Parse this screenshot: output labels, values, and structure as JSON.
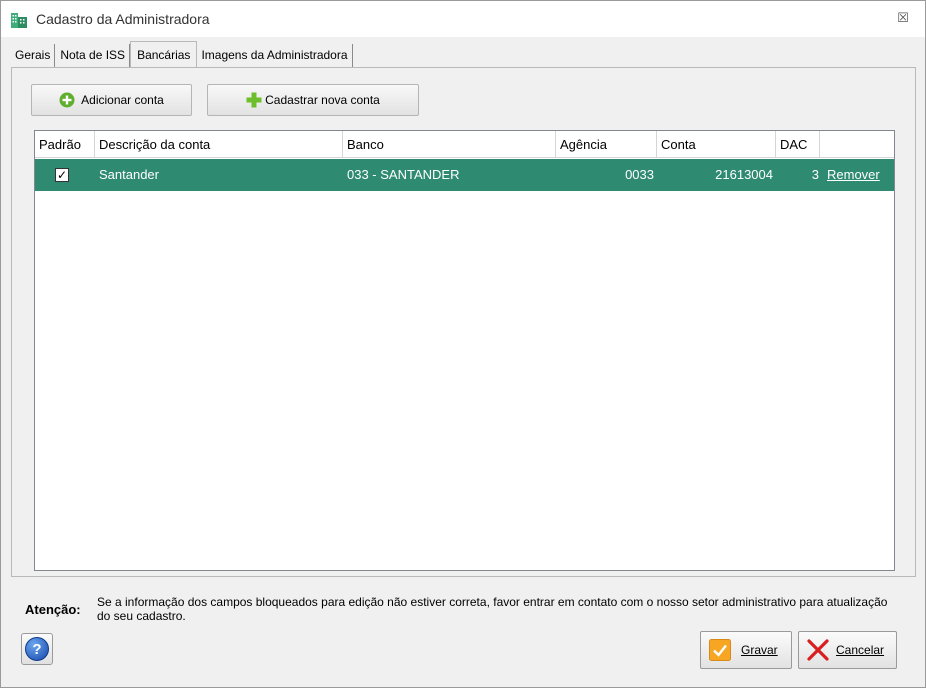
{
  "window": {
    "title": "Cadastro da Administradora",
    "close_glyph": "☒"
  },
  "tabs": [
    {
      "label": "Gerais",
      "active": false
    },
    {
      "label": "Nota de ISS",
      "active": false
    },
    {
      "label": "Bancárias",
      "active": true
    },
    {
      "label": "Imagens da Administradora",
      "active": false
    }
  ],
  "toolbar": {
    "add_account_label": "Adicionar conta",
    "register_account_label": "Cadastrar nova conta"
  },
  "grid": {
    "columns": [
      "Padrão",
      "Descrição da conta",
      "Banco",
      "Agência",
      "Conta",
      "DAC"
    ],
    "rows": [
      {
        "default_checked": true,
        "descricao": "Santander",
        "banco": "033 - SANTANDER",
        "agencia": "0033",
        "conta": "21613004",
        "dac": "3",
        "action": "Remover"
      }
    ],
    "selected_row_color": "#2e8a70"
  },
  "attention": {
    "label": "Atenção:",
    "text": "Se a informação dos campos bloqueados para edição não estiver correta, favor entrar em contato com o nosso setor administrativo para atualização do seu cadastro."
  },
  "footer": {
    "help_glyph": "?",
    "save_label": "Gravar",
    "cancel_label": "Cancelar"
  },
  "icons": {
    "title": "building-icon",
    "add": "plus-circle-icon",
    "register": "plus-icon",
    "save": "checkmark-icon",
    "cancel": "x-icon",
    "help": "help-icon"
  }
}
